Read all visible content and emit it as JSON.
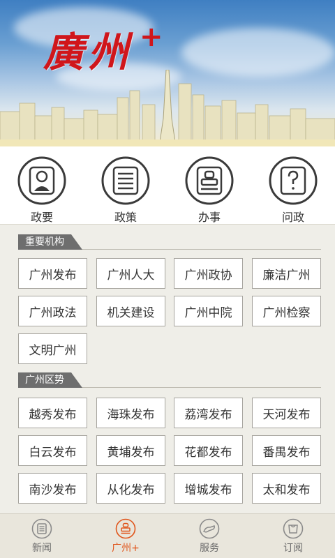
{
  "banner": {
    "title": "廣州",
    "plus": "+"
  },
  "categories": [
    {
      "label": "政要",
      "icon": "person-icon"
    },
    {
      "label": "政策",
      "icon": "document-icon"
    },
    {
      "label": "办事",
      "icon": "stamp-icon"
    },
    {
      "label": "问政",
      "icon": "question-icon"
    }
  ],
  "sections": [
    {
      "title": "重要机构",
      "items": [
        "广州发布",
        "广州人大",
        "广州政协",
        "廉洁广州",
        "广州政法",
        "机关建设",
        "广州中院",
        "广州检察",
        "文明广州"
      ]
    },
    {
      "title": "广州区势",
      "items": [
        "越秀发布",
        "海珠发布",
        "荔湾发布",
        "天河发布",
        "白云发布",
        "黄埔发布",
        "花都发布",
        "番禺发布",
        "南沙发布",
        "从化发布",
        "增城发布",
        "太和发布"
      ]
    }
  ],
  "tabs": [
    {
      "label": "新闻",
      "icon": "news-icon",
      "active": false
    },
    {
      "label": "广州+",
      "icon": "guangzhou-plus-icon",
      "active": true
    },
    {
      "label": "服务",
      "icon": "service-icon",
      "active": false
    },
    {
      "label": "订阅",
      "icon": "subscribe-icon",
      "active": false
    }
  ],
  "colors": {
    "accent": "#e0551b",
    "brand_red": "#d0161b",
    "tag_bg": "#6e6e6e"
  }
}
